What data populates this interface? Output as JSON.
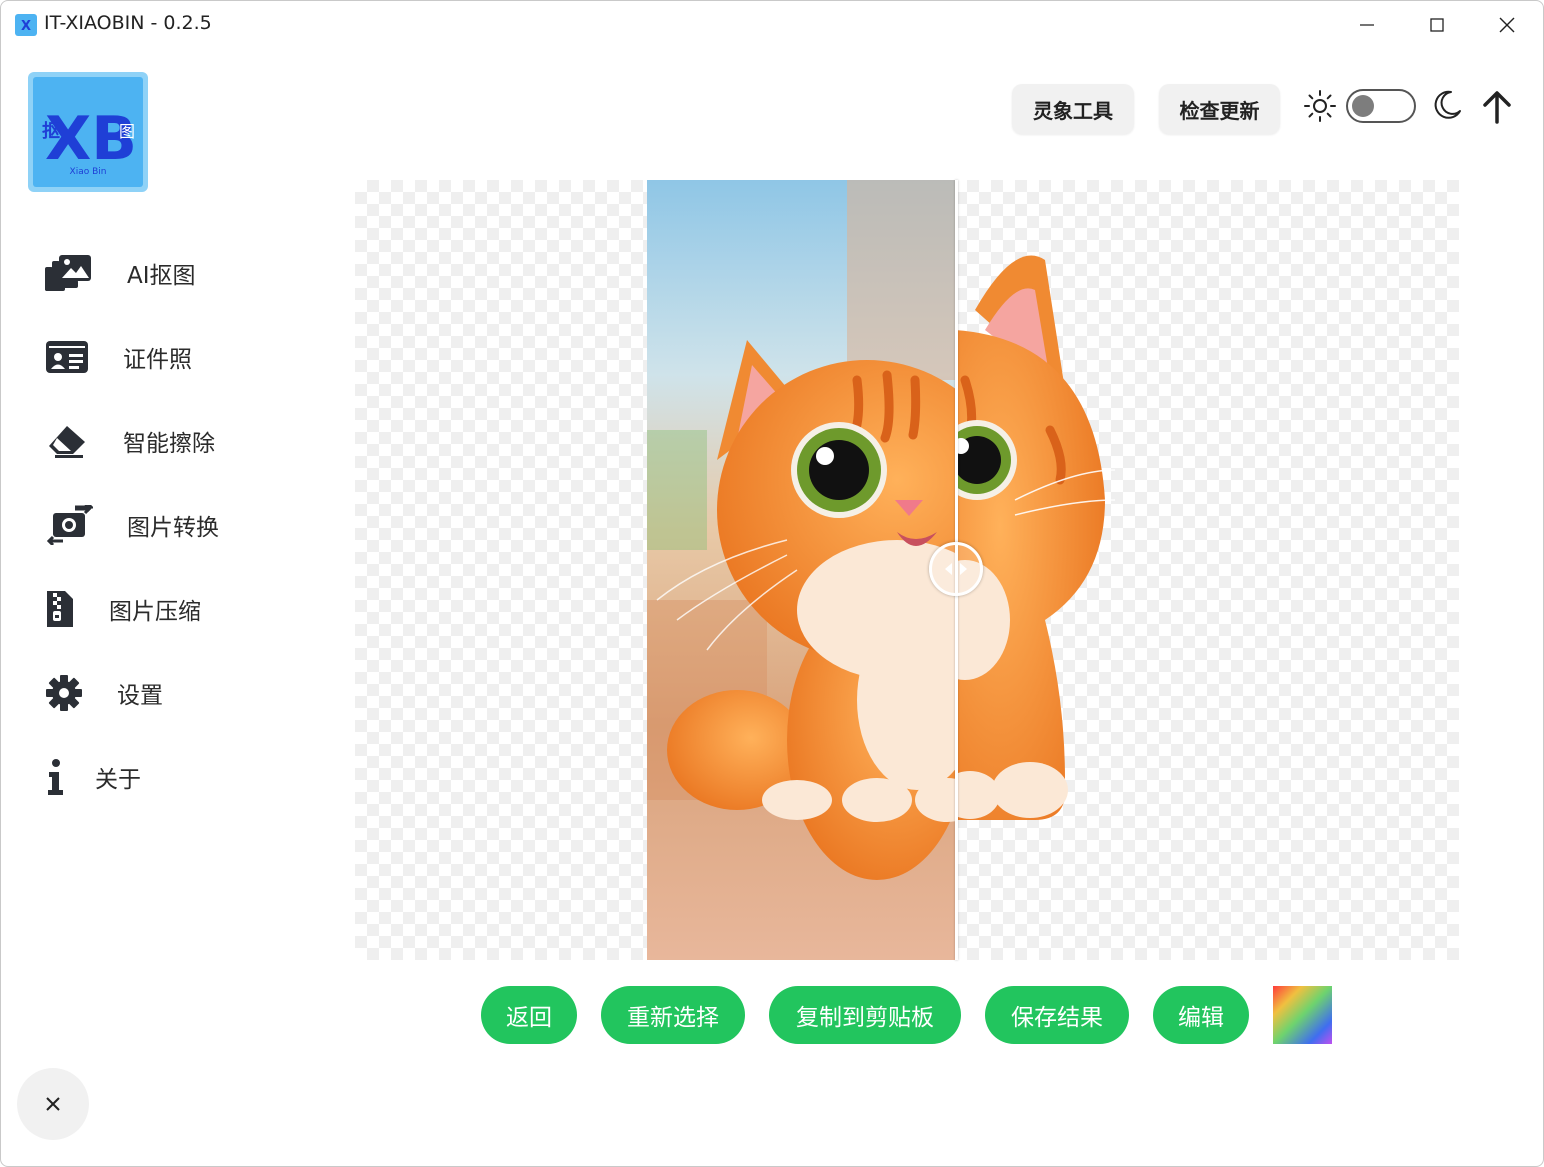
{
  "window": {
    "title": "IT-XIAOBIN - 0.2.5"
  },
  "logo": {
    "main": "XB",
    "left": "抠",
    "right": "图",
    "sub": "Xiao Bin"
  },
  "sidebar": {
    "items": [
      {
        "label": "AI抠图",
        "icon": "images-icon"
      },
      {
        "label": "证件照",
        "icon": "id-card-icon"
      },
      {
        "label": "智能擦除",
        "icon": "eraser-icon"
      },
      {
        "label": "图片转换",
        "icon": "convert-icon"
      },
      {
        "label": "图片压缩",
        "icon": "zip-file-icon"
      },
      {
        "label": "设置",
        "icon": "gear-icon"
      },
      {
        "label": "关于",
        "icon": "info-icon"
      }
    ]
  },
  "header": {
    "tools_label": "灵象工具",
    "update_label": "检查更新",
    "theme_toggle": {
      "dark": false
    }
  },
  "actions": {
    "back": "返回",
    "reselect": "重新选择",
    "copy": "复制到剪贴板",
    "save": "保存结果",
    "edit": "编辑"
  },
  "compare": {
    "split_fraction": 0.54
  },
  "colors": {
    "accent": "#22c55e",
    "logo_bg": "#4db3f2",
    "logo_x": "#1f3fd6"
  }
}
